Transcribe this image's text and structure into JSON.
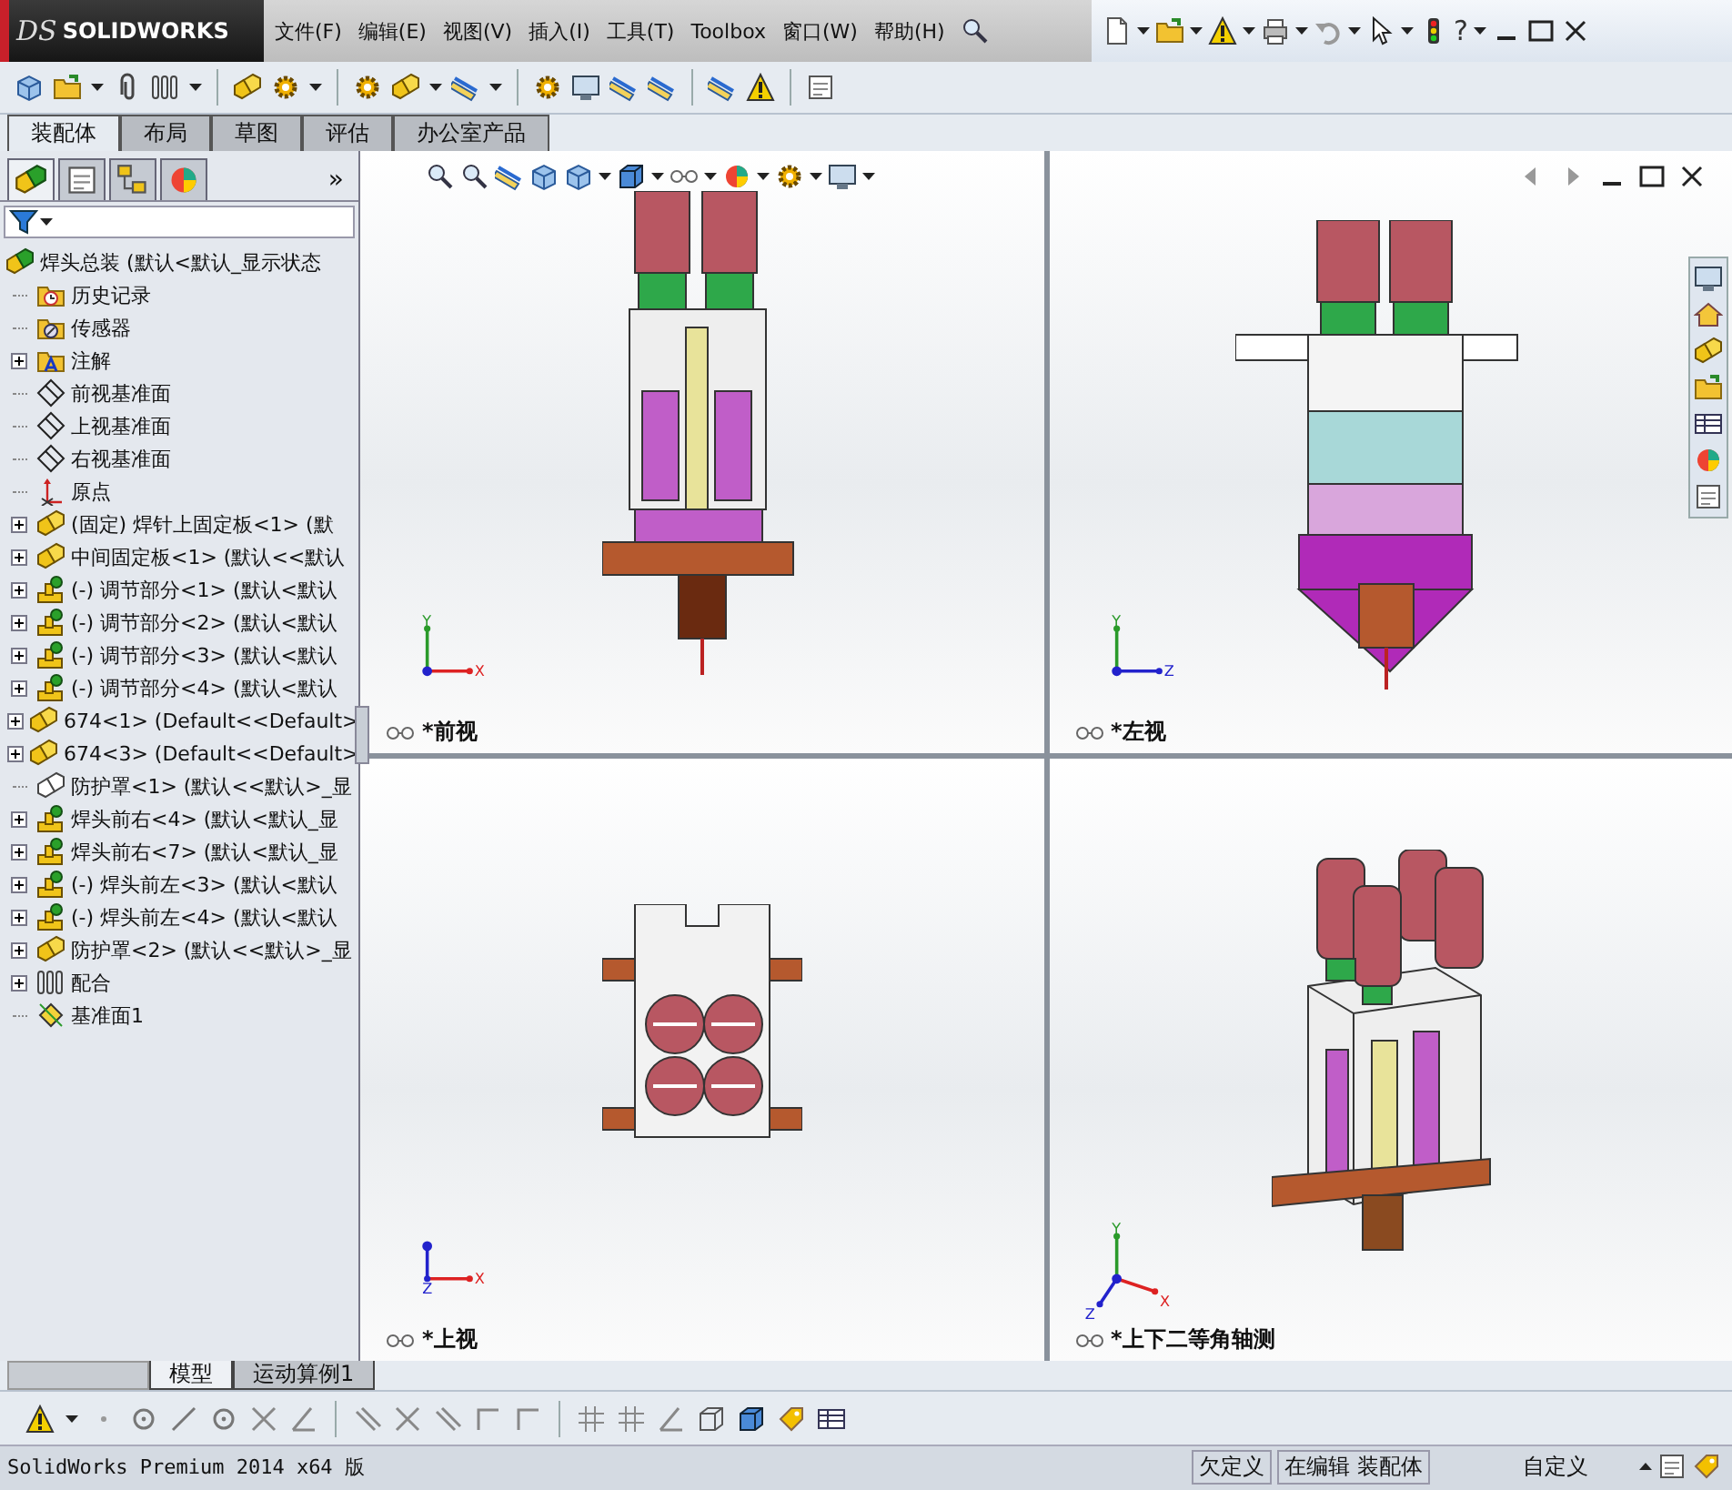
{
  "title_bar": {
    "logo_mark": "DS",
    "logo": "SOLIDWORKS",
    "menu": [
      "文件(F)",
      "编辑(E)",
      "视图(V)",
      "插入(I)",
      "工具(T)",
      "Toolbox",
      "窗口(W)",
      "帮助(H)"
    ],
    "help_glyph": "?"
  },
  "command_tabs": [
    {
      "label": "装配体",
      "selected": true
    },
    {
      "label": "布局",
      "selected": false
    },
    {
      "label": "草图",
      "selected": false
    },
    {
      "label": "评估",
      "selected": false
    },
    {
      "label": "办公室产品",
      "selected": false
    }
  ],
  "feature_manager": {
    "more": "»",
    "tree": {
      "label": "焊头总装 (默认<默认_显示状态",
      "kind": "assembly",
      "children": [
        {
          "label": "历史记录",
          "kind": "history",
          "expandable": false
        },
        {
          "label": "传感器",
          "kind": "sensor",
          "expandable": false
        },
        {
          "label": "注解",
          "kind": "annotation",
          "expandable": true
        },
        {
          "label": "前视基准面",
          "kind": "plane",
          "expandable": false
        },
        {
          "label": "上视基准面",
          "kind": "plane",
          "expandable": false
        },
        {
          "label": "右视基准面",
          "kind": "plane",
          "expandable": false
        },
        {
          "label": "原点",
          "kind": "origin",
          "expandable": false
        },
        {
          "label": "(固定) 焊针上固定板<1> (默",
          "kind": "blocks",
          "expandable": true
        },
        {
          "label": "中间固定板<1> (默认<<默认",
          "kind": "blocks",
          "expandable": true
        },
        {
          "label": "(-) 调节部分<1> (默认<默认",
          "kind": "pin",
          "expandable": true
        },
        {
          "label": "(-) 调节部分<2> (默认<默认",
          "kind": "pin",
          "expandable": true
        },
        {
          "label": "(-) 调节部分<3> (默认<默认",
          "kind": "pin",
          "expandable": true
        },
        {
          "label": "(-) 调节部分<4> (默认<默认",
          "kind": "pin",
          "expandable": true
        },
        {
          "label": "674<1> (Default<<Default>",
          "kind": "blocks",
          "expandable": true
        },
        {
          "label": "674<3> (Default<<Default>",
          "kind": "blocks",
          "expandable": true
        },
        {
          "label": "防护罩<1> (默认<<默认>_显",
          "kind": "outline",
          "expandable": false
        },
        {
          "label": "焊头前右<4> (默认<默认_显",
          "kind": "pin",
          "expandable": true
        },
        {
          "label": "焊头前右<7> (默认<默认_显",
          "kind": "pin",
          "expandable": true
        },
        {
          "label": "(-) 焊头前左<3> (默认<默认",
          "kind": "pin",
          "expandable": true
        },
        {
          "label": "(-) 焊头前左<4> (默认<默认",
          "kind": "pin",
          "expandable": true
        },
        {
          "label": "防护罩<2> (默认<<默认>_显",
          "kind": "blocks",
          "expandable": true
        },
        {
          "label": "配合",
          "kind": "mates",
          "expandable": true
        },
        {
          "label": "基准面1",
          "kind": "sketch-plane",
          "expandable": false
        }
      ]
    }
  },
  "viewports": [
    {
      "label": "*前视",
      "kind": "front",
      "axes": [
        "Y",
        "X"
      ]
    },
    {
      "label": "*左视",
      "kind": "left",
      "axes": [
        "Y",
        "Z"
      ]
    },
    {
      "label": "*上视",
      "kind": "top",
      "axes": [
        "X",
        "Z"
      ]
    },
    {
      "label": "*上下二等角轴测",
      "kind": "iso",
      "axes": [
        "Y",
        "X",
        "Z"
      ]
    }
  ],
  "bottom_tabs": [
    {
      "label": "模型",
      "selected": true
    },
    {
      "label": "运动算例1",
      "selected": false
    }
  ],
  "status_bar": {
    "product": "SolidWorks Premium 2014 x64 版",
    "definition": "欠定义",
    "editing": "在编辑 装配体",
    "units": "自定义"
  }
}
